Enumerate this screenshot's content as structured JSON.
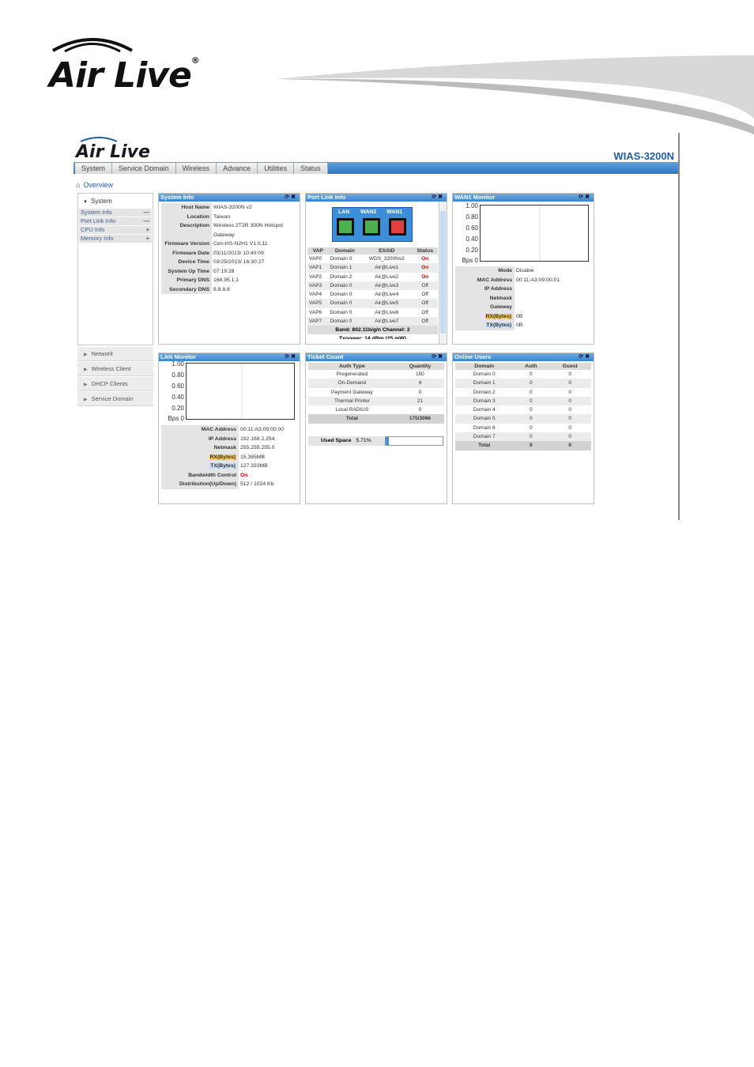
{
  "page": {
    "brand": "Air Live",
    "brand_mark": "®"
  },
  "app": {
    "logo": "Air Live",
    "model": "WIAS-3200N",
    "nav": [
      "System",
      "Service Domain",
      "Wireless",
      "Advance",
      "Utilities",
      "Status"
    ],
    "breadcrumb": "Overview"
  },
  "sidebar": {
    "header": "System",
    "items": [
      {
        "label": "System Info",
        "sign": "—"
      },
      {
        "label": "Port Link Info",
        "sign": "—"
      },
      {
        "label": "CPU Info",
        "sign": "+"
      },
      {
        "label": "Memory Info",
        "sign": "+"
      }
    ],
    "menu": [
      "Network",
      "Wireless Client",
      "DHCP Clients",
      "Service Domain"
    ]
  },
  "system_info": {
    "title": "System Info",
    "rows": [
      {
        "k": "Host Name",
        "v": "WIAS-3200N v2"
      },
      {
        "k": "Location",
        "v": "Taiwan"
      },
      {
        "k": "Description",
        "v": "Wireless 2T2R 300N Hotspot Gateway"
      },
      {
        "k": "Firmware Version",
        "v": "Cen-HS-N2H1 V1.0.11"
      },
      {
        "k": "Firmware Date",
        "v": "03/11/2013/ 10:40:09"
      },
      {
        "k": "Device Time",
        "v": "03/25/2013/ 16:30:27"
      },
      {
        "k": "System Up Time",
        "v": "07:19:28"
      },
      {
        "k": "Primary DNS",
        "v": "168.95.1.1"
      },
      {
        "k": "Secondary DNS",
        "v": "8.8.8.8"
      }
    ]
  },
  "port_link": {
    "title": "Port Link Info",
    "ports": [
      "LAN",
      "WAN2",
      "WAN1"
    ],
    "headers": [
      "VAP",
      "Domain",
      "ESSID",
      "Status"
    ],
    "rows": [
      [
        "VAP0",
        "Domain 0",
        "WDS_3200Nv2",
        "On"
      ],
      [
        "VAP1",
        "Domain 1",
        "Air@Live1",
        "On"
      ],
      [
        "VAP2",
        "Domain 2",
        "Air@Live2",
        "On"
      ],
      [
        "VAP3",
        "Domain 0",
        "Air@Live3",
        "Off"
      ],
      [
        "VAP4",
        "Domain 0",
        "Air@Live4",
        "Off"
      ],
      [
        "VAP5",
        "Domain 0",
        "Air@Live5",
        "Off"
      ],
      [
        "VAP6",
        "Domain 0",
        "Air@Live6",
        "Off"
      ],
      [
        "VAP7",
        "Domain 0",
        "Air@Live7",
        "Off"
      ]
    ],
    "band": "Band: 802.11b/g/n Channel: 2",
    "txpower": "Txpower: 14 dBm (25 mW)"
  },
  "wan1": {
    "title": "WAN1 Monitor",
    "yticks": [
      "1.00",
      "0.80",
      "0.60",
      "0.40",
      "0.20",
      "Bps 0"
    ],
    "rows": [
      {
        "k": "Mode",
        "v": "Disable"
      },
      {
        "k": "MAC Address",
        "v": "00:11:A3:09:00:01"
      },
      {
        "k": "IP Address",
        "v": ""
      },
      {
        "k": "Netmask",
        "v": ""
      },
      {
        "k": "Gateway",
        "v": ""
      },
      {
        "k": "RX(Bytes)",
        "v": "0B"
      },
      {
        "k": "TX(Bytes)",
        "v": "0B"
      }
    ]
  },
  "lan": {
    "title": "LAN Monitor",
    "yticks": [
      "1.00",
      "0.80",
      "0.60",
      "0.40",
      "0.20",
      "Bps 0"
    ],
    "rows": [
      {
        "k": "MAC Address",
        "v": "00:11:A3:09:00:00"
      },
      {
        "k": "IP Address",
        "v": "192.168.2.254"
      },
      {
        "k": "Netmask",
        "v": "255.255.255.0"
      },
      {
        "k": "RX(Bytes)",
        "v": "15.385MB"
      },
      {
        "k": "TX(Bytes)",
        "v": "127.333MB"
      },
      {
        "k": "Bandwidth Control",
        "v": "On"
      },
      {
        "k": "Distribution(Up/Down)",
        "v": "512 / 1024 Kb"
      }
    ]
  },
  "ticket": {
    "title": "Ticket Count",
    "headers": [
      "Auth Type",
      "Quantity"
    ],
    "rows": [
      [
        "Pregenerated",
        "150"
      ],
      [
        "On-Demand",
        "4"
      ],
      [
        "Payment Gateway",
        "0"
      ],
      [
        "Thermal Printer",
        "21"
      ],
      [
        "Local RADIUS",
        "0"
      ]
    ],
    "total": [
      "Total",
      "175/3066"
    ],
    "used_label": "Used Space",
    "used_value": "5.71%",
    "used_fraction": 0.0571
  },
  "online": {
    "title": "Online Users",
    "headers": [
      "Domain",
      "Auth",
      "Guest"
    ],
    "rows": [
      [
        "Domain 0",
        "0",
        "0"
      ],
      [
        "Domain 1",
        "0",
        "0"
      ],
      [
        "Domain 2",
        "0",
        "0"
      ],
      [
        "Domain 3",
        "0",
        "0"
      ],
      [
        "Domain 4",
        "0",
        "0"
      ],
      [
        "Domain 5",
        "0",
        "0"
      ],
      [
        "Domain 6",
        "0",
        "0"
      ],
      [
        "Domain 7",
        "0",
        "0"
      ]
    ],
    "total": [
      "Total",
      "0",
      "0"
    ]
  },
  "colors": {
    "accent": "#3a83cf",
    "port_lan": "#4caf50",
    "port_wan2": "#4caf50",
    "port_wan1": "#e04040",
    "on": "#dd0000"
  },
  "icons": {
    "panel_controls": [
      "refresh-icon",
      "close-icon"
    ],
    "breadcrumb": "home-icon"
  }
}
